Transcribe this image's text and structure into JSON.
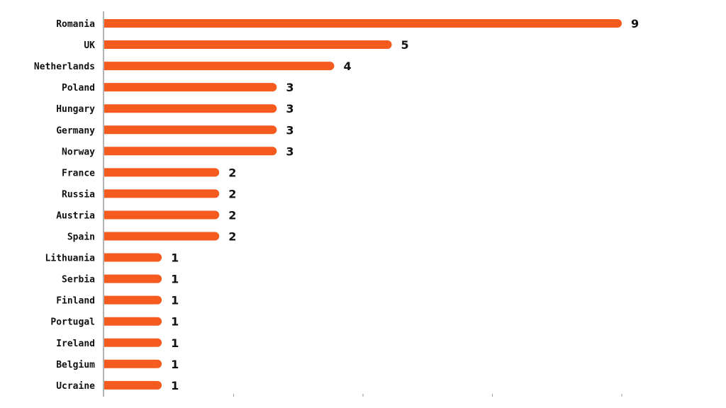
{
  "chart_data": {
    "type": "bar",
    "orientation": "horizontal",
    "title": "",
    "xlabel": "",
    "ylabel": "",
    "categories": [
      "Romania",
      "UK",
      "Netherlands",
      "Poland",
      "Hungary",
      "Germany",
      "Norway",
      "France",
      "Russia",
      "Austria",
      "Spain",
      "Lithuania",
      "Serbia",
      "Finland",
      "Portugal",
      "Ireland",
      "Belgium",
      "Ucraine"
    ],
    "values": [
      9,
      5,
      4,
      3,
      3,
      3,
      3,
      2,
      2,
      2,
      2,
      1,
      1,
      1,
      1,
      1,
      1,
      1
    ],
    "xlim": [
      0,
      9
    ],
    "x_ticks": [
      2.25,
      4.5,
      6.75,
      9
    ],
    "x_tick_labels_shown": false,
    "grid": false,
    "legend": "none",
    "bar_color": "#F55A1E",
    "data_labels": true
  }
}
